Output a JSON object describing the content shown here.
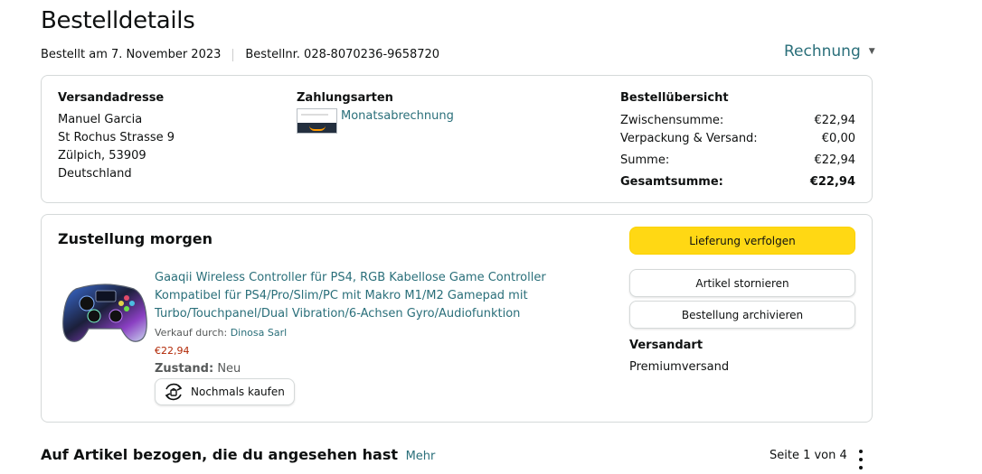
{
  "page": {
    "title": "Bestelldetails",
    "ordered_on": "Bestellt am 7. November 2023",
    "order_number": "Bestellnr. 028-8070236-9658720",
    "invoice_label": "Rechnung"
  },
  "shipping_address": {
    "heading": "Versandadresse",
    "lines": [
      "Manuel Garcia",
      "St Rochus Strasse 9",
      "Zülpich, 53909",
      "Deutschland"
    ]
  },
  "payment": {
    "heading": "Zahlungsarten",
    "method": "Monatsabrechnung"
  },
  "summary": {
    "heading": "Bestellübersicht",
    "rows": [
      {
        "label": "Zwischensumme:",
        "value": "€22,94"
      },
      {
        "label": "Verpackung & Versand:",
        "value": "€0,00"
      },
      {
        "label": "Summe:",
        "value": "€22,94"
      }
    ],
    "grand_label": "Gesamtsumme:",
    "grand_value": "€22,94"
  },
  "delivery": {
    "heading": "Zustellung morgen",
    "product_title": "Gaaqii Wireless Controller für PS4, RGB Kabellose Game Controller Kompatibel für PS4/Pro/Slim/PC mit Makro M1/M2 Gamepad mit Turbo/Touchpanel/Dual Vibration/6-Achsen Gyro/Audiofunktion",
    "seller_prefix": "Verkauf durch:",
    "seller_name": "Dinosa Sarl",
    "price": "€22,94",
    "condition_label": "Zustand:",
    "condition_value": "Neu",
    "buy_again_label": "Nochmals kaufen",
    "track_label": "Lieferung verfolgen",
    "cancel_label": "Artikel stornieren",
    "archive_label": "Bestellung archivieren",
    "shipping_type_heading": "Versandart",
    "shipping_type_value": "Premiumversand"
  },
  "related": {
    "title": "Auf Artikel bezogen, die du angesehen hast",
    "more_label": "Mehr",
    "pager": "Seite 1 von 4"
  },
  "colors": {
    "link": "#2a6f7a",
    "price": "#b12704",
    "button_primary": "#ffd814",
    "border": "#d5d9d9"
  },
  "icons": {
    "payment": "amazon-card-icon",
    "buy_again": "buy-again-icon",
    "invoice": "chevron-down-icon",
    "menu": "kebab-menu-icon"
  }
}
